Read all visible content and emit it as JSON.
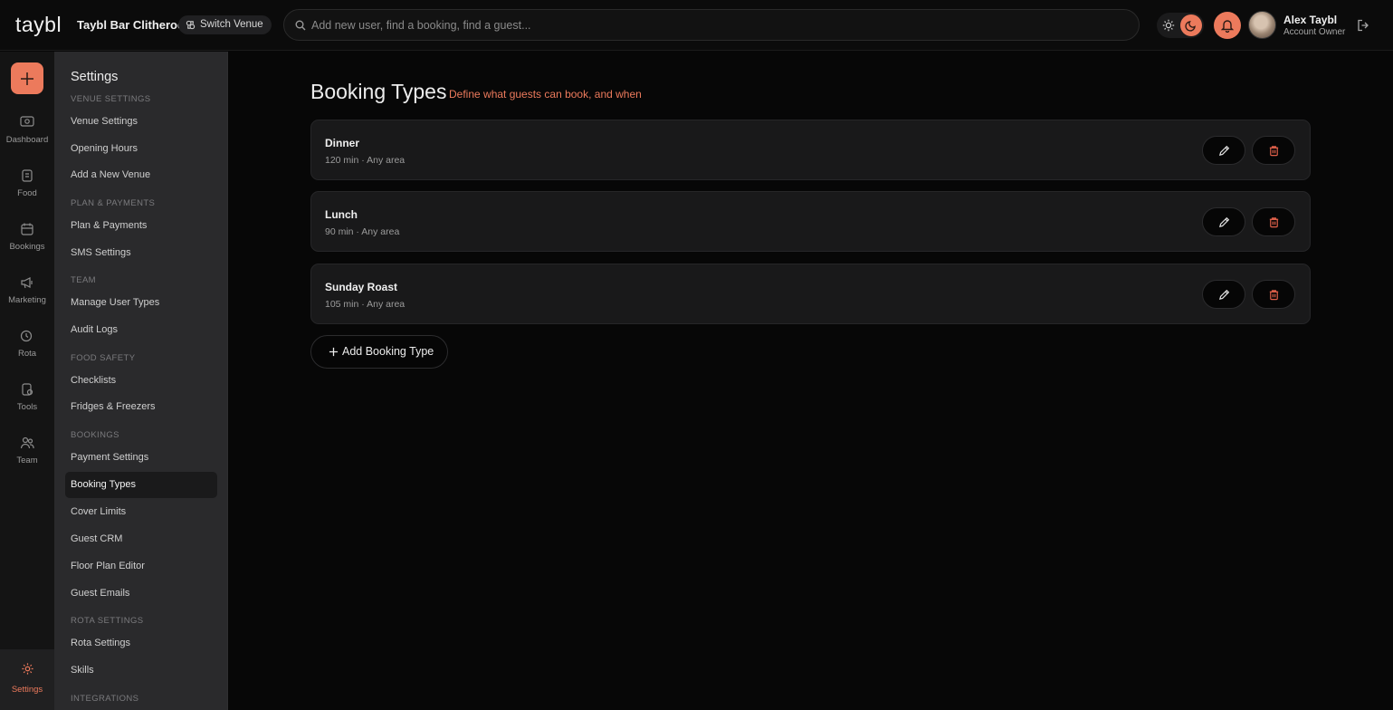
{
  "header": {
    "logo": "taybl",
    "venue_name": "Taybl Bar Clitheroe",
    "switch_venue_label": "Switch Venue",
    "search_placeholder": "Add new user, find a booking, find a guest...",
    "user_name": "Alex Taybl",
    "user_role": "Account Owner"
  },
  "rail": {
    "items": [
      {
        "label": "Dashboard",
        "icon": "dashboard-icon"
      },
      {
        "label": "Food",
        "icon": "food-icon"
      },
      {
        "label": "Bookings",
        "icon": "bookings-icon"
      },
      {
        "label": "Marketing",
        "icon": "megaphone-icon"
      },
      {
        "label": "Rota",
        "icon": "rota-icon"
      },
      {
        "label": "Tools",
        "icon": "tools-icon"
      },
      {
        "label": "Team",
        "icon": "team-icon"
      }
    ],
    "settings_label": "Settings"
  },
  "settings_nav": {
    "title": "Settings",
    "sections": [
      {
        "label": "VENUE SETTINGS",
        "items": [
          "Venue Settings",
          "Opening Hours",
          "Add a New Venue"
        ]
      },
      {
        "label": "PLAN & PAYMENTS",
        "items": [
          "Plan & Payments",
          "SMS Settings"
        ]
      },
      {
        "label": "TEAM",
        "items": [
          "Manage User Types",
          "Audit Logs"
        ]
      },
      {
        "label": "FOOD SAFETY",
        "items": [
          "Checklists",
          "Fridges & Freezers"
        ]
      },
      {
        "label": "BOOKINGS",
        "items": [
          "Payment Settings",
          "Booking Types",
          "Cover Limits",
          "Guest CRM",
          "Floor Plan Editor",
          "Guest Emails"
        ]
      },
      {
        "label": "ROTA SETTINGS",
        "items": [
          "Rota Settings",
          "Skills"
        ]
      },
      {
        "label": "INTEGRATIONS",
        "items": []
      }
    ],
    "active_item": "Booking Types"
  },
  "main": {
    "title": "Booking Types",
    "subtitle": "Define what guests can book, and when",
    "booking_types": [
      {
        "name": "Dinner",
        "meta": "120 min · Any area"
      },
      {
        "name": "Lunch",
        "meta": "90 min · Any area"
      },
      {
        "name": "Sunday Roast",
        "meta": "105 min · Any area"
      }
    ],
    "add_button_label": "Add Booking Type"
  },
  "colors": {
    "accent": "#ec7a5c",
    "background": "#070707",
    "sidebar": "#2a2a2c",
    "card": "#19191a"
  }
}
